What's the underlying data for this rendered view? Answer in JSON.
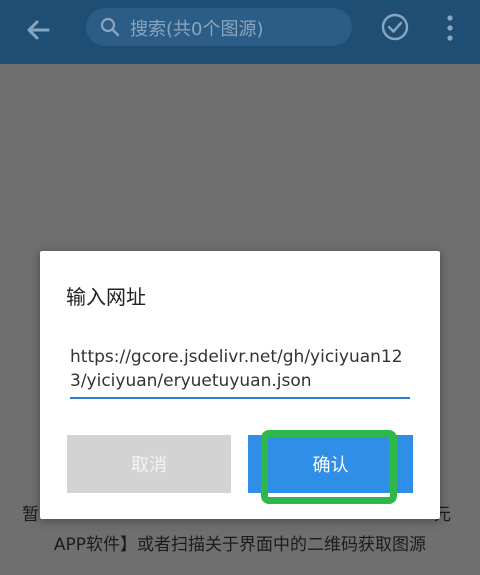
{
  "appbar": {
    "search_placeholder": "搜索(共0个图源)",
    "icons": [
      "back-arrow-icon",
      "search-icon",
      "check-circle-icon",
      "more-vertical-icon"
    ]
  },
  "background": {
    "line1_start": "暂",
    "line1_end": "元",
    "line2": "APP软件】或者扫描关于界面中的二维码获取图源"
  },
  "dialog": {
    "title": "输入网址",
    "url_value": "https://gcore.jsdelivr.net/gh/yiciyuan123/yiciyuan/eryuetuyuan.json",
    "cancel_label": "取消",
    "confirm_label": "确认"
  },
  "colors": {
    "appbar": "#1f4e74",
    "overlay": "#6f6f6f",
    "confirm": "#2f8fe6",
    "cancel": "#d3d3d3",
    "highlight": "#2fb84a",
    "field_underline": "#2a7fd4"
  }
}
